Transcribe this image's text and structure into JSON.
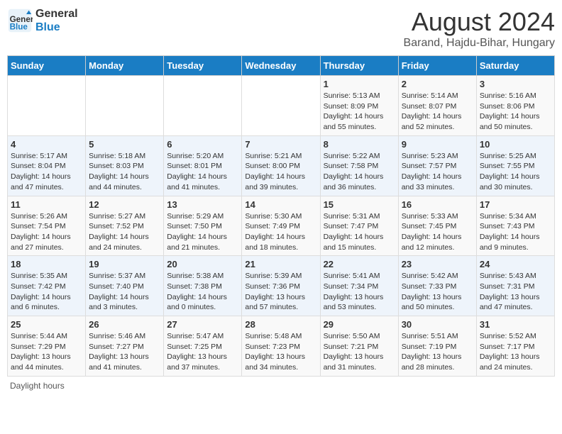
{
  "header": {
    "logo_line1": "General",
    "logo_line2": "Blue",
    "main_title": "August 2024",
    "subtitle": "Barand, Hajdu-Bihar, Hungary"
  },
  "calendar": {
    "days_of_week": [
      "Sunday",
      "Monday",
      "Tuesday",
      "Wednesday",
      "Thursday",
      "Friday",
      "Saturday"
    ],
    "weeks": [
      [
        {
          "day": "",
          "content": ""
        },
        {
          "day": "",
          "content": ""
        },
        {
          "day": "",
          "content": ""
        },
        {
          "day": "",
          "content": ""
        },
        {
          "day": "1",
          "content": "Sunrise: 5:13 AM\nSunset: 8:09 PM\nDaylight: 14 hours and 55 minutes."
        },
        {
          "day": "2",
          "content": "Sunrise: 5:14 AM\nSunset: 8:07 PM\nDaylight: 14 hours and 52 minutes."
        },
        {
          "day": "3",
          "content": "Sunrise: 5:16 AM\nSunset: 8:06 PM\nDaylight: 14 hours and 50 minutes."
        }
      ],
      [
        {
          "day": "4",
          "content": "Sunrise: 5:17 AM\nSunset: 8:04 PM\nDaylight: 14 hours and 47 minutes."
        },
        {
          "day": "5",
          "content": "Sunrise: 5:18 AM\nSunset: 8:03 PM\nDaylight: 14 hours and 44 minutes."
        },
        {
          "day": "6",
          "content": "Sunrise: 5:20 AM\nSunset: 8:01 PM\nDaylight: 14 hours and 41 minutes."
        },
        {
          "day": "7",
          "content": "Sunrise: 5:21 AM\nSunset: 8:00 PM\nDaylight: 14 hours and 39 minutes."
        },
        {
          "day": "8",
          "content": "Sunrise: 5:22 AM\nSunset: 7:58 PM\nDaylight: 14 hours and 36 minutes."
        },
        {
          "day": "9",
          "content": "Sunrise: 5:23 AM\nSunset: 7:57 PM\nDaylight: 14 hours and 33 minutes."
        },
        {
          "day": "10",
          "content": "Sunrise: 5:25 AM\nSunset: 7:55 PM\nDaylight: 14 hours and 30 minutes."
        }
      ],
      [
        {
          "day": "11",
          "content": "Sunrise: 5:26 AM\nSunset: 7:54 PM\nDaylight: 14 hours and 27 minutes."
        },
        {
          "day": "12",
          "content": "Sunrise: 5:27 AM\nSunset: 7:52 PM\nDaylight: 14 hours and 24 minutes."
        },
        {
          "day": "13",
          "content": "Sunrise: 5:29 AM\nSunset: 7:50 PM\nDaylight: 14 hours and 21 minutes."
        },
        {
          "day": "14",
          "content": "Sunrise: 5:30 AM\nSunset: 7:49 PM\nDaylight: 14 hours and 18 minutes."
        },
        {
          "day": "15",
          "content": "Sunrise: 5:31 AM\nSunset: 7:47 PM\nDaylight: 14 hours and 15 minutes."
        },
        {
          "day": "16",
          "content": "Sunrise: 5:33 AM\nSunset: 7:45 PM\nDaylight: 14 hours and 12 minutes."
        },
        {
          "day": "17",
          "content": "Sunrise: 5:34 AM\nSunset: 7:43 PM\nDaylight: 14 hours and 9 minutes."
        }
      ],
      [
        {
          "day": "18",
          "content": "Sunrise: 5:35 AM\nSunset: 7:42 PM\nDaylight: 14 hours and 6 minutes."
        },
        {
          "day": "19",
          "content": "Sunrise: 5:37 AM\nSunset: 7:40 PM\nDaylight: 14 hours and 3 minutes."
        },
        {
          "day": "20",
          "content": "Sunrise: 5:38 AM\nSunset: 7:38 PM\nDaylight: 14 hours and 0 minutes."
        },
        {
          "day": "21",
          "content": "Sunrise: 5:39 AM\nSunset: 7:36 PM\nDaylight: 13 hours and 57 minutes."
        },
        {
          "day": "22",
          "content": "Sunrise: 5:41 AM\nSunset: 7:34 PM\nDaylight: 13 hours and 53 minutes."
        },
        {
          "day": "23",
          "content": "Sunrise: 5:42 AM\nSunset: 7:33 PM\nDaylight: 13 hours and 50 minutes."
        },
        {
          "day": "24",
          "content": "Sunrise: 5:43 AM\nSunset: 7:31 PM\nDaylight: 13 hours and 47 minutes."
        }
      ],
      [
        {
          "day": "25",
          "content": "Sunrise: 5:44 AM\nSunset: 7:29 PM\nDaylight: 13 hours and 44 minutes."
        },
        {
          "day": "26",
          "content": "Sunrise: 5:46 AM\nSunset: 7:27 PM\nDaylight: 13 hours and 41 minutes."
        },
        {
          "day": "27",
          "content": "Sunrise: 5:47 AM\nSunset: 7:25 PM\nDaylight: 13 hours and 37 minutes."
        },
        {
          "day": "28",
          "content": "Sunrise: 5:48 AM\nSunset: 7:23 PM\nDaylight: 13 hours and 34 minutes."
        },
        {
          "day": "29",
          "content": "Sunrise: 5:50 AM\nSunset: 7:21 PM\nDaylight: 13 hours and 31 minutes."
        },
        {
          "day": "30",
          "content": "Sunrise: 5:51 AM\nSunset: 7:19 PM\nDaylight: 13 hours and 28 minutes."
        },
        {
          "day": "31",
          "content": "Sunrise: 5:52 AM\nSunset: 7:17 PM\nDaylight: 13 hours and 24 minutes."
        }
      ]
    ]
  },
  "footer": {
    "note": "Daylight hours"
  }
}
